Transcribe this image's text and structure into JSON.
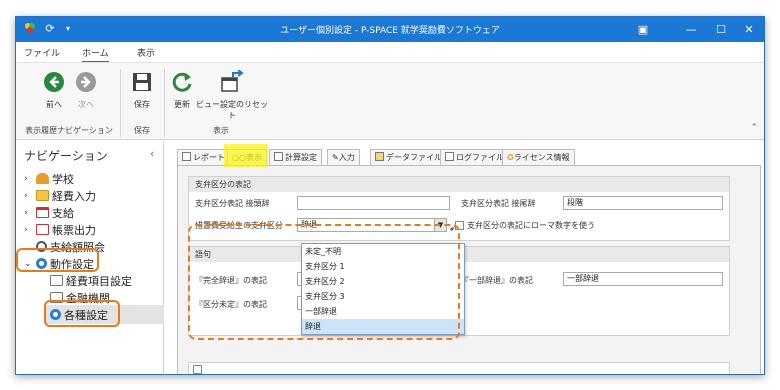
{
  "window": {
    "title": "ユーザー個別設定 - P-SPACE 就学奨励費ソフトウェア"
  },
  "menu": {
    "file": "ファイル",
    "home": "ホーム",
    "view": "表示"
  },
  "ribbon": {
    "back": "前へ",
    "forward": "次へ",
    "save": "保存",
    "refresh": "更新",
    "reset_view": "ビュー設定のリセット",
    "group_nav": "表示履歴ナビゲーション",
    "group_save": "保存",
    "group_view": "表示"
  },
  "nav": {
    "header": "ナビゲーション",
    "collapse": "‹",
    "items": [
      {
        "label": "学校"
      },
      {
        "label": "経費入力"
      },
      {
        "label": "支給"
      },
      {
        "label": "帳票出力"
      },
      {
        "label": "支給額照会"
      },
      {
        "label": "動作設定"
      },
      {
        "label": "経費項目設定"
      },
      {
        "label": "金融機関"
      },
      {
        "label": "各種設定"
      }
    ]
  },
  "tabs": [
    {
      "label": "レポート"
    },
    {
      "label": "表示"
    },
    {
      "label": "計算設定"
    },
    {
      "label": "入力"
    },
    {
      "label": "データファイル"
    },
    {
      "label": "ログファイル"
    },
    {
      "label": "ライセンス情報"
    }
  ],
  "section1": {
    "title": "支弁区分の表記",
    "prefix_label": "支弁区分表記 接頭辞",
    "prefix_value": "",
    "suffix_label": "支弁区分表記 接尾辞",
    "suffix_value": "段階",
    "combo_label": "措置費受給生の支弁区分",
    "combo_value": "辞退",
    "roman_label": "支弁区分の表記にローマ数字を使う"
  },
  "section2": {
    "title": "語句",
    "full_label": "『完全辞退』の表記",
    "partial_label": "『一部辞退』の表記",
    "partial_value": "一部辞退",
    "undecided_label": "『区分未定』の表記"
  },
  "dropdown": {
    "options": [
      "未定_不明",
      "支弁区分 1",
      "支弁区分 2",
      "支弁区分 3",
      "一部辞退",
      "辞退"
    ],
    "selected_index": 5
  }
}
